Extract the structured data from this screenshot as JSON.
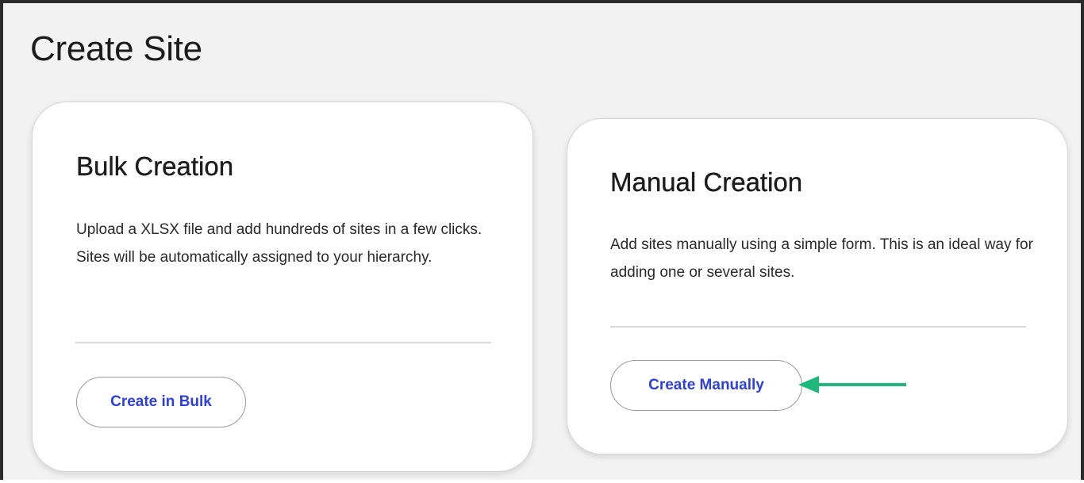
{
  "page": {
    "title": "Create Site"
  },
  "cards": {
    "bulk": {
      "title": "Bulk Creation",
      "description": "Upload a XLSX file and add hundreds of sites in a few clicks. Sites will be automatically assigned to your hierarchy.",
      "button_label": "Create in Bulk"
    },
    "manual": {
      "title": "Manual Creation",
      "description": "Add sites manually using a simple form. This is an ideal way for adding one or several sites.",
      "button_label": "Create Manually"
    }
  },
  "annotation": {
    "arrow_icon": "left-arrow-icon",
    "arrow_color": "#1db87a"
  },
  "colors": {
    "link_blue": "#2c3fe0",
    "page_background": "#f2f2f2",
    "card_background": "#ffffff"
  }
}
